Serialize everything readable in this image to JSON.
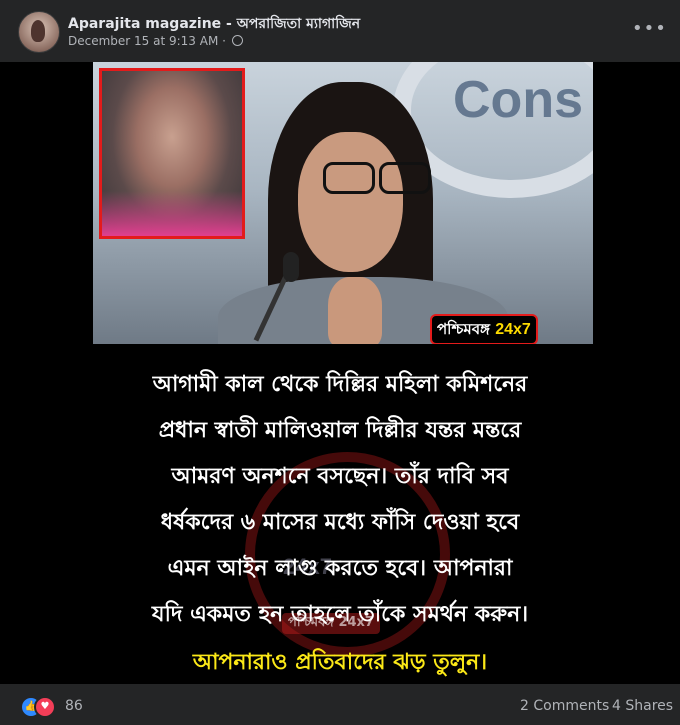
{
  "post": {
    "page_name": "Aparajita magazine - অপরাজিতা ম্যাগাজিন",
    "timestamp": "December 15 at 9:13 AM",
    "privacy_separator": "·",
    "audience_icon": "globe-icon",
    "more_icon": "more-options-icon"
  },
  "image": {
    "background_word": "Cons",
    "badge": {
      "bengali": "পশ্চিমবঙ্গ",
      "suffix": "24x7"
    },
    "watermark": {
      "text": "24x7",
      "label": "পশ্চিমবঙ্গ 24x7"
    },
    "caption_lines": [
      "আগামী কাল থেকে দিল্লির মহিলা কমিশনের",
      "প্রধান স্বাতী মালিওয়াল দিল্লীর যন্তর মন্তরে",
      "আমরণ অনশনে বসছেন। তাঁর দাবি সব",
      "ধর্ষকদের ৬ মাসের মধ্যে ফাঁসি দেওয়া হবে",
      "এমন আইন লাগু করতে হবে। আপনারা",
      "যদি একমত হন তাহলে তাঁকে সমর্থন করুন।"
    ],
    "caption_highlight": "আপনারাও প্রতিবাদের ঝড় তুলুন।",
    "colors": {
      "badge_border": "#e31b1b",
      "highlight": "#fbe817"
    }
  },
  "footer": {
    "reaction_icons": [
      "like-icon",
      "love-icon"
    ],
    "reaction_count": "86",
    "comments": "2 Comments",
    "shares": "4 Shares"
  }
}
